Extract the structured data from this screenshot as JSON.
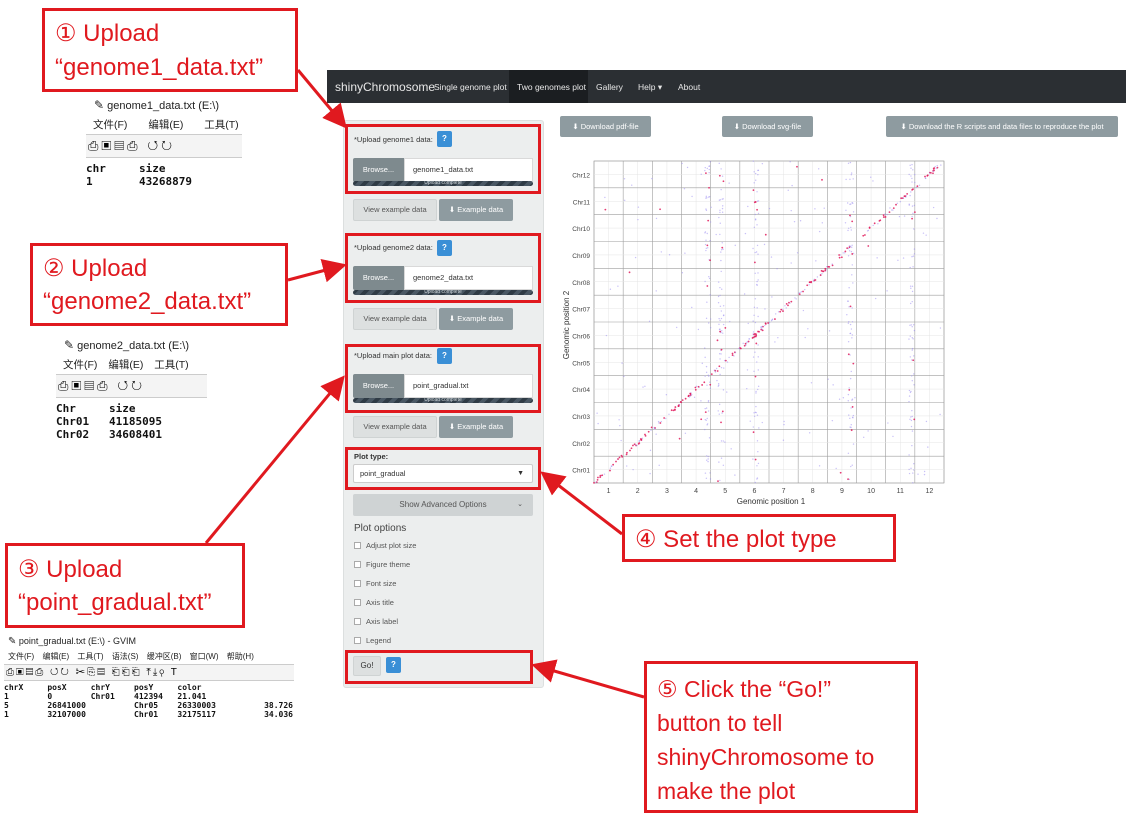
{
  "navbar": {
    "brand": "shinyChromosome",
    "items": [
      "Single genome plot",
      "Two genomes plot",
      "Gallery",
      "Help ▾",
      "About"
    ]
  },
  "uploads": [
    {
      "label": "*Upload genome1 data:",
      "browse": "Browse...",
      "file": "genome1_data.txt",
      "status": "Upload complete"
    },
    {
      "label": "*Upload genome2 data:",
      "browse": "Browse...",
      "file": "genome2_data.txt",
      "status": "Upload complete"
    },
    {
      "label": "*Upload main plot data:",
      "browse": "Browse...",
      "file": "point_gradual.txt",
      "status": "Upload complete"
    }
  ],
  "buttons": {
    "view_example": "View example data",
    "example_data": "Example data",
    "go": "Go!",
    "help": "?"
  },
  "plot_type": {
    "label": "Plot type:",
    "value": "point_gradual"
  },
  "advanced": "Show Advanced Options",
  "plot_options": {
    "heading": "Plot options",
    "items": [
      "Adjust plot size",
      "Figure theme",
      "Font size",
      "Axis title",
      "Axis label",
      "Legend"
    ]
  },
  "downloads": [
    "Download pdf-file",
    "Download svg-file",
    "Download the R scripts and data files to reproduce the plot"
  ],
  "chart_data": {
    "type": "scatter",
    "xlabel": "Genomic position 1",
    "ylabel": "Genomic position 2",
    "x_ticks": [
      "1",
      "2",
      "3",
      "4",
      "5",
      "6",
      "7",
      "8",
      "9",
      "10",
      "11",
      "12"
    ],
    "y_ticks": [
      "Chr01",
      "Chr02",
      "Chr03",
      "Chr04",
      "Chr05",
      "Chr06",
      "Chr07",
      "Chr08",
      "Chr09",
      "Chr10",
      "Chr11",
      "Chr12"
    ],
    "colors": {
      "low": "#9b8cf0",
      "high": "#e0195a"
    },
    "grid": true
  },
  "callouts": [
    {
      "line1": "① Upload",
      "line2": "“genome1_data.txt”"
    },
    {
      "line1": "② Upload",
      "line2": "“genome2_data.txt”"
    },
    {
      "line1": "③ Upload",
      "line2": "“point_gradual.txt”"
    },
    {
      "line1": "④ Set the plot type"
    },
    {
      "line1": "⑤ Click the “Go!”",
      "line2": "button to tell",
      "line3": "shinyChromosome to",
      "line4": "make the plot"
    }
  ],
  "editor1": {
    "title": "genome1_data.txt (E:\\)",
    "menus": [
      "文件(F)",
      "编辑(E)",
      "工具(T)"
    ],
    "lines": [
      "chr     size",
      "1       43268879"
    ]
  },
  "editor2": {
    "title": "genome2_data.txt (E:\\)",
    "menus": [
      "文件(F)",
      "编辑(E)",
      "工具(T)"
    ],
    "lines": [
      "Chr     size",
      "Chr01   41185095",
      "Chr02   34608401"
    ]
  },
  "editor3": {
    "title": "point_gradual.txt (E:\\) - GVIM",
    "menus": [
      "文件(F)",
      "编辑(E)",
      "工具(T)",
      "语法(S)",
      "缓冲区(B)",
      "窗口(W)",
      "帮助(H)"
    ],
    "lines": [
      "chrX     posX     chrY     posY     color",
      "1        0        Chr01    412394   21.041",
      "5        26841000          Chr05    26330003          38.726",
      "1        32107000          Chr01    32175117          34.036"
    ]
  }
}
